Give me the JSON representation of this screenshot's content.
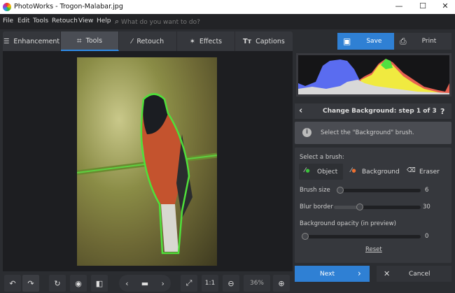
{
  "window": {
    "title": "PhotoWorks - Trogon-Malabar.jpg",
    "minimize": "—",
    "maximize": "☐",
    "close": "✕"
  },
  "menu": {
    "items": [
      "File",
      "Edit",
      "Tools",
      "Retouch",
      "View",
      "Help"
    ],
    "search_placeholder": "What do you want to do?"
  },
  "tabs": [
    {
      "label": "Enhancement",
      "icon": "sliders-icon"
    },
    {
      "label": "Tools",
      "icon": "crop-icon",
      "active": true
    },
    {
      "label": "Retouch",
      "icon": "brush-icon"
    },
    {
      "label": "Effects",
      "icon": "magic-wand-icon"
    },
    {
      "label": "Captions",
      "icon": "text-icon"
    }
  ],
  "toolbar": {
    "save": "Save",
    "print": "Print"
  },
  "step": {
    "title": "Change Background: step 1 of 3",
    "help": "?",
    "back": "‹"
  },
  "info": {
    "text": "Select the \"Background\" brush."
  },
  "brush": {
    "label": "Select a brush:",
    "options": [
      {
        "label": "Object",
        "selected": true,
        "dot": "#3bc43b"
      },
      {
        "label": "Background",
        "dot": "#f07030"
      },
      {
        "label": "Eraser"
      }
    ]
  },
  "sliders": [
    {
      "label": "Brush size",
      "value": "6",
      "fraction": 0.03
    },
    {
      "label": "Blur border",
      "value": "30",
      "fraction": 0.3
    },
    {
      "label": "Background opacity (in preview)",
      "value": "0",
      "fraction": 0
    }
  ],
  "reset": "Reset",
  "actions": {
    "next": "Next",
    "cancel": "Cancel"
  },
  "bottom": {
    "one_to_one": "1:1",
    "zoom": "36%"
  },
  "colors": {
    "accent": "#2f80d4"
  }
}
